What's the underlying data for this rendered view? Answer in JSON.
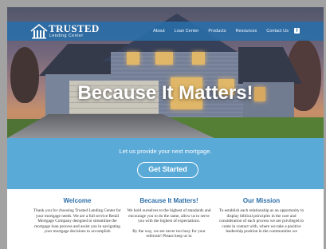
{
  "nav": {
    "logo_title": "TRUSTED",
    "logo_subtitle": "Lending Center",
    "links": [
      "About",
      "Loan Center",
      "Products",
      "Resources",
      "Contact Us"
    ],
    "social_icon": "facebook-icon"
  },
  "hero": {
    "headline": "Because It Matters!"
  },
  "band": {
    "tagline": "Let us provide your next mortgage.",
    "cta_label": "Get Started"
  },
  "columns": [
    {
      "title": "Welcome",
      "paragraphs": [
        "Thank you for choosing Trusted Lending Center for your mortgage needs. We are a full service Retail Mortgage Company designed to streamline the mortgage loan process and assist you in navigating your mortgage decisions to accomplish"
      ]
    },
    {
      "title": "Because It Matters!",
      "paragraphs": [
        "We hold ourselves to the highest of standards and encourage you to do the same, allow us to serve you with the highest of expectations.",
        "By the way, we are never too busy for your referrals! Please keep us in"
      ]
    },
    {
      "title": "Our Mission",
      "paragraphs": [
        "To establish each relationship as an opportunity to display biblical principles in the care and consideration of each process we are privileged to come in contact with, where we take a positive leadership position in the communities we"
      ]
    }
  ],
  "colors": {
    "nav_bg": "#2e6ea8",
    "band_bg": "#5aaad8",
    "heading_blue": "#2c6fa8"
  }
}
